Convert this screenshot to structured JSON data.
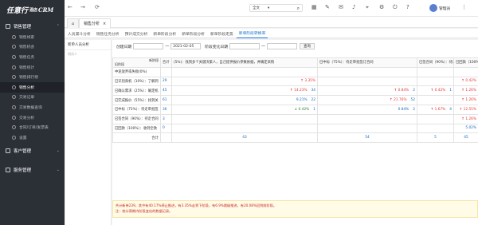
{
  "app": {
    "logo_main": "任意行",
    "logo_sub": "酒店",
    "logo_crm": "CRM"
  },
  "sidebar": {
    "groups": [
      {
        "label": "销售管理"
      },
      {
        "label": "客户管理"
      },
      {
        "label": "服务管理"
      }
    ],
    "items": [
      {
        "label": "销售线索"
      },
      {
        "label": "销售机会"
      },
      {
        "label": "销售任务"
      },
      {
        "label": "销售统计"
      },
      {
        "label": "销售排行榜"
      },
      {
        "label": "销售分析"
      },
      {
        "label": "交易记录"
      },
      {
        "label": "交易数据查询"
      },
      {
        "label": "交易分析"
      },
      {
        "label": "合同/订单/发票表"
      },
      {
        "label": "设置"
      }
    ]
  },
  "topbar": {
    "search_scope": "全文",
    "user_name": "管理员"
  },
  "tabs": {
    "home_icon_label": "",
    "active_tab": "销售分析"
  },
  "subtabs": [
    "人员漏斗分析",
    "销售任务分析",
    "预计成交分析",
    "新单阶段分析",
    "新单阶段分析",
    "新单阶段走势",
    "新单阶段转换率"
  ],
  "panel": {
    "header": "新单人员分析",
    "sub": "测试人"
  },
  "filters": {
    "create_label": "创建日期",
    "date_from": "",
    "sep": "一",
    "date_to": "2021-02-05",
    "stage_label": "阶段变化日期",
    "stage_from": "",
    "stage_to": "",
    "query_btn": "查询"
  },
  "grid": {
    "corner_top": "新阶段",
    "corner_bottom": "旧阶段",
    "columns": [
      "合计",
      "(5%)：找到多个关键决策人，自己提供报价参数依据，并确定采购",
      "已中标（75%）：待走审批签订合同",
      "已签合同（90%）：待走合同付款",
      "已回款（100%）"
    ],
    "rows": [
      {
        "label": "中途放弃或失败(0%)",
        "total": "",
        "c1": "",
        "c2": "",
        "c3": "",
        "c4": ""
      },
      {
        "label": "已识别商机（10%）：了解到",
        "total": "29",
        "c1": "3.35%",
        "c1d": "up",
        "c2": "",
        "c3": "",
        "c4": "0.42%",
        "c4d": "up"
      },
      {
        "label": "已确认需求（25%）：确定机",
        "total": "45",
        "c1": "14.23%",
        "c1d": "up",
        "c1n": "34",
        "c2": "0.84%",
        "c2d": "up",
        "c2n": "2",
        "c3": "0.42%",
        "c3d": "up",
        "c3n": "1",
        "c4": "1.26%",
        "c4d": "up"
      },
      {
        "label": "已完成报价（55%）：找到关",
        "total": "61",
        "c1": "9.21%",
        "c1n": "22",
        "c2": "21.76%",
        "c2d": "up",
        "c2n": "52",
        "c3": "",
        "c4": "1.26%",
        "c4d": "up"
      },
      {
        "label": "已中标（75%）：待走审批签",
        "total": "36",
        "c1": "0.42%",
        "c1d": "down",
        "c1n": "1",
        "c2": "0.84%",
        "c2n": "2",
        "c3": "1.67%",
        "c3d": "up",
        "c3n": "4",
        "c4": "12.55%",
        "c4d": "up"
      },
      {
        "label": "已签合同（90%）：待走合同",
        "total": "3",
        "c1": "",
        "c2": "",
        "c3": "",
        "c4": "1.26%",
        "c4d": "up"
      },
      {
        "label": "已回款（100%）：收到全款",
        "total": "0",
        "c1": "",
        "c2": "",
        "c3": "",
        "c4": "5.02%"
      },
      {
        "label": "合计",
        "total": "",
        "c1": "43",
        "c2": "54",
        "c3": "5",
        "c4": "45"
      }
    ]
  },
  "note": {
    "line1": "共计新单239，其中有40.17%停止推进，有3.35%走到下阶段，有6.9%跳级推进，有20.08%回到前阶段。",
    "line2": "注：统计周期内阶段变化的数据记录。"
  },
  "colors": {
    "sidebar_bg": "#2b2f36",
    "accent": "#1976d2",
    "up": "#e53935",
    "down": "#2e7d32"
  }
}
